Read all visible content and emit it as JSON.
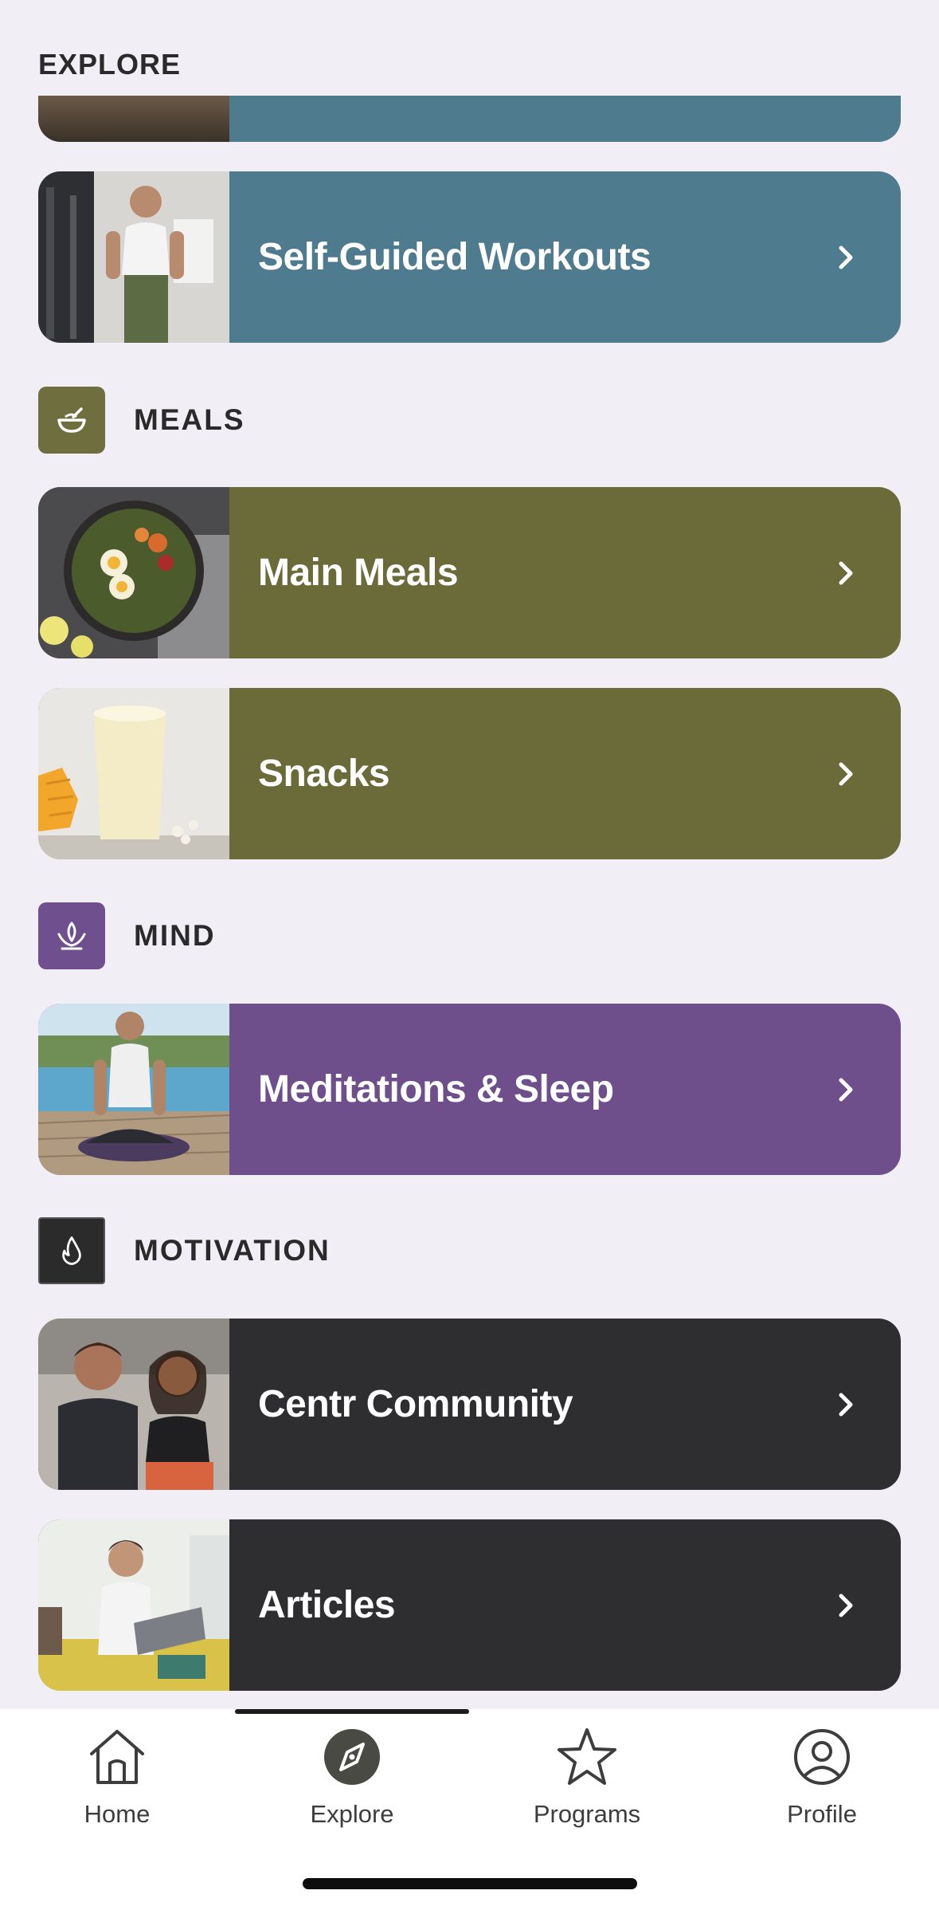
{
  "header": {
    "title": "EXPLORE"
  },
  "colors": {
    "workouts": "#4f7b8f",
    "meals": "#6b6b3a",
    "meals_icon": "#6e6e3e",
    "mind": "#6e4f8c",
    "mind_icon": "#6f4f8e",
    "motivation": "#2e2d2f",
    "motivation_icon": "#2b2b2b",
    "background": "#f1eff5"
  },
  "cards": {
    "self_guided": {
      "label": "Self-Guided Workouts",
      "thumb": "man-gym-cable-machine"
    },
    "main_meals": {
      "label": "Main Meals",
      "thumb": "egg-salad-bowl"
    },
    "snacks": {
      "label": "Snacks",
      "thumb": "mango-smoothie"
    },
    "meditations": {
      "label": "Meditations & Sleep",
      "thumb": "man-meditating-poolside"
    },
    "community": {
      "label": "Centr Community",
      "thumb": "couple-smiling-selfie"
    },
    "articles": {
      "label": "Articles",
      "thumb": "woman-laptop-sofa"
    }
  },
  "sections": {
    "meals": {
      "label": "MEALS",
      "icon": "bowl-icon"
    },
    "mind": {
      "label": "MIND",
      "icon": "lotus-icon"
    },
    "motivation": {
      "label": "MOTIVATION",
      "icon": "flame-icon"
    }
  },
  "tabbar": {
    "active": "explore",
    "tabs": [
      {
        "label": "Home",
        "icon": "home-icon"
      },
      {
        "label": "Explore",
        "icon": "compass-icon"
      },
      {
        "label": "Programs",
        "icon": "star-icon"
      },
      {
        "label": "Profile",
        "icon": "profile-icon"
      }
    ]
  }
}
